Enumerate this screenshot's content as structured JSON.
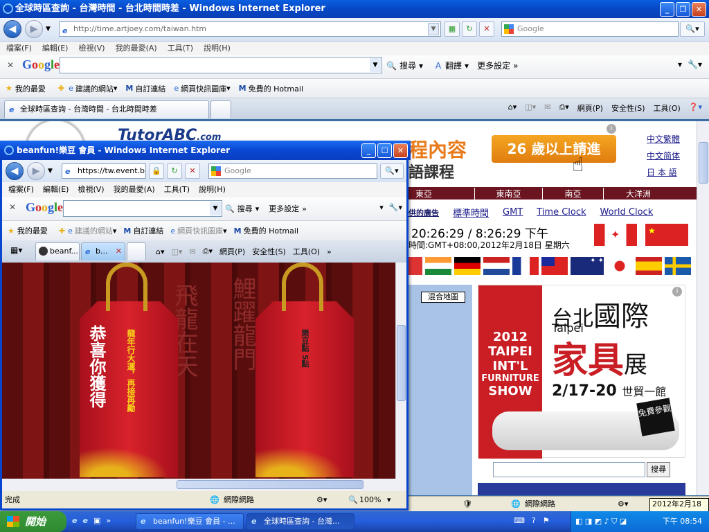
{
  "main": {
    "title": "全球時區查詢 - 台灣時間 - 台北時間時差 - Windows Internet Explorer",
    "url": "http://time.artjoey.com/taiwan.htm",
    "search_placeholder": "Google",
    "menu": [
      "檔案(F)",
      "編輯(E)",
      "檢視(V)",
      "我的最愛(A)",
      "工具(T)",
      "說明(H)"
    ],
    "google_bar": {
      "logo": "Google",
      "search": "搜尋",
      "translate": "翻譯",
      "more": "更多設定"
    },
    "favorites": {
      "fav": "我的最愛",
      "suggested": "建議的網站",
      "custom_links": "自訂連結",
      "web_slices": "網頁快訊圖庫",
      "hotmail": "免費的 Hotmail"
    },
    "tab_label": "全球時區查詢 - 台灣時間 - 台北時間時差",
    "tools": [
      "網頁(P)",
      "安全性(S)",
      "工具(O)"
    ],
    "status": {
      "zone": "網際網路",
      "date": "2012年2月18日"
    }
  },
  "site": {
    "header_logo": "TutorABC",
    "header_logo_com": ".com",
    "ad_text1": "程內容",
    "ad_text2": "語課程",
    "ad_button": "26 歲以上請進",
    "lang_links": [
      "中文繁體",
      "中文简体",
      "日 本 語"
    ],
    "regions": [
      "東亞",
      "東南亞",
      "南亞",
      "大洋洲"
    ],
    "link_bar": {
      "provided": "供的廣告",
      "links": [
        "標準時間",
        "GMT",
        "Time Clock",
        "World Clock"
      ]
    },
    "clock": "20:26:29 / 8:26:29 下午",
    "clock_sub": "時間:GMT+08:00,2012年2月18日 星期六",
    "map_button": "混合地圖",
    "expo": {
      "title_a": "台北",
      "title_b": "國際",
      "taipei": "Taipei",
      "year": "2012",
      "l1": "TAIPEI",
      "l2": "INT'L",
      "l3": "FURNITURE",
      "l4": "SHOW",
      "big": "家具",
      "big2": "展",
      "dates": "2/17-20",
      "venue": "世貿一館",
      "free": "免費參觀"
    },
    "search_btn": "搜尋"
  },
  "popup": {
    "title": "beanfun!樂豆 會員 - Windows Internet Explorer",
    "url": "https://tw.event.b",
    "search_placeholder": "Google",
    "menu": [
      "檔案(F)",
      "編輯(E)",
      "檢視(V)",
      "我的最愛(A)",
      "工具(T)",
      "說明(H)"
    ],
    "google_bar": {
      "logo": "Google",
      "search": "搜尋",
      "more": "更多設定"
    },
    "favorites": {
      "fav": "我的最愛",
      "suggested": "建議的網站",
      "custom_links": "自訂連結",
      "web_slices": "網頁快訊圖庫",
      "hotmail": "免費的 Hotmail"
    },
    "tabs": [
      "beanf...",
      "b..."
    ],
    "tools": [
      "網頁(P)",
      "安全性(S)",
      "工具(O)"
    ],
    "tag1_main": "恭喜你獲得",
    "tag1_side": "龍年行大運，再接再勵",
    "tag2_main": "樂豆點 5點",
    "bg_chars1": "飛龍在天",
    "bg_chars2": "鯉躍龍門",
    "status": {
      "done": "完成",
      "zone": "網際網路",
      "zoom": "100%"
    }
  },
  "taskbar": {
    "start": "開始",
    "btn1": "beanfun!樂豆 會員 - ...",
    "btn2": "全球時區查詢 - 台灣...",
    "clock": "下午 08:54"
  }
}
